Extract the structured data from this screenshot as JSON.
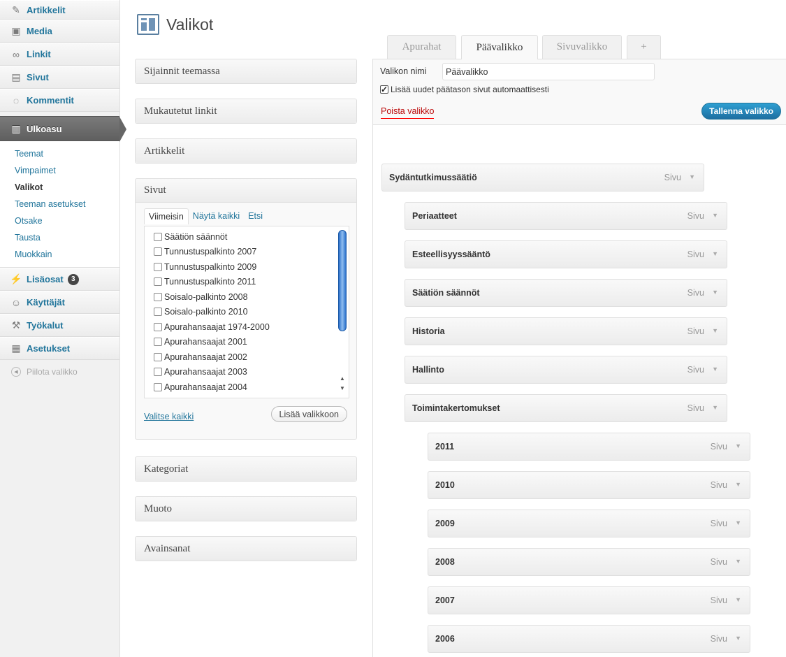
{
  "sidebar": {
    "items": [
      {
        "label": "Artikkelit",
        "icon": "pushpin-icon"
      },
      {
        "label": "Media",
        "icon": "media-icon"
      },
      {
        "label": "Linkit",
        "icon": "link-icon"
      },
      {
        "label": "Sivut",
        "icon": "pages-icon"
      },
      {
        "label": "Kommentit",
        "icon": "comment-icon"
      }
    ],
    "current": {
      "label": "Ulkoasu",
      "icon": "appearance-icon"
    },
    "submenu": [
      "Teemat",
      "Vimpaimet",
      "Valikot",
      "Teeman asetukset",
      "Otsake",
      "Tausta",
      "Muokkain"
    ],
    "submenu_current": "Valikot",
    "lower_items": [
      {
        "label": "Lisäosat",
        "icon": "plugin-icon",
        "badge": "3"
      },
      {
        "label": "Käyttäjät",
        "icon": "users-icon"
      },
      {
        "label": "Työkalut",
        "icon": "tools-icon"
      },
      {
        "label": "Asetukset",
        "icon": "settings-icon"
      }
    ],
    "collapse_label": "Piilota valikko"
  },
  "page": {
    "title": "Valikot"
  },
  "metaboxes": {
    "sijainnit": "Sijainnit teemassa",
    "mukautetut": "Mukautetut linkit",
    "artikkelit": "Artikkelit",
    "sivut": "Sivut",
    "kategoriat": "Kategoriat",
    "muoto": "Muoto",
    "avainsanat": "Avainsanat"
  },
  "pages_box": {
    "tabs": [
      "Viimeisin",
      "Näytä kaikki",
      "Etsi"
    ],
    "items": [
      "Säätiön säännöt",
      "Tunnustuspalkinto 2007",
      "Tunnustuspalkinto 2009",
      "Tunnustuspalkinto 2011",
      "Soisalo-palkinto 2008",
      "Soisalo-palkinto 2010",
      "Apurahansaajat 1974-2000",
      "Apurahansaajat 2001",
      "Apurahansaajat 2002",
      "Apurahansaajat 2003",
      "Apurahansaajat 2004"
    ],
    "select_all": "Valitse kaikki",
    "add_button": "Lisää valikkoon"
  },
  "menu_tabs": [
    "Apurahat",
    "Päävalikko",
    "Sivuvalikko",
    "+"
  ],
  "active_menu_tab": "Päävalikko",
  "menu_editor": {
    "name_label": "Valikon nimi",
    "name_value": "Päävalikko",
    "auto_add_label": "Lisää uudet päätason sivut automaattisesti",
    "auto_add_checked": true,
    "delete_label": "Poista valikko",
    "save_label": "Tallenna valikko"
  },
  "menu_items": [
    {
      "title": "Sydäntutkimussäätiö",
      "type": "Sivu",
      "depth": 0
    },
    {
      "title": "Periaatteet",
      "type": "Sivu",
      "depth": 1
    },
    {
      "title": "Esteellisyyssääntö",
      "type": "Sivu",
      "depth": 1
    },
    {
      "title": "Säätiön säännöt",
      "type": "Sivu",
      "depth": 1
    },
    {
      "title": "Historia",
      "type": "Sivu",
      "depth": 1
    },
    {
      "title": "Hallinto",
      "type": "Sivu",
      "depth": 1
    },
    {
      "title": "Toimintakertomukset",
      "type": "Sivu",
      "depth": 1
    },
    {
      "title": "2011",
      "type": "Sivu",
      "depth": 2
    },
    {
      "title": "2010",
      "type": "Sivu",
      "depth": 2
    },
    {
      "title": "2009",
      "type": "Sivu",
      "depth": 2
    },
    {
      "title": "2008",
      "type": "Sivu",
      "depth": 2
    },
    {
      "title": "2007",
      "type": "Sivu",
      "depth": 2
    },
    {
      "title": "2006",
      "type": "Sivu",
      "depth": 2
    }
  ],
  "colors": {
    "link": "#21759b",
    "save_button": "#21759b",
    "delete_link": "#bc0b0b",
    "current_menu": "#6d6d6d"
  }
}
